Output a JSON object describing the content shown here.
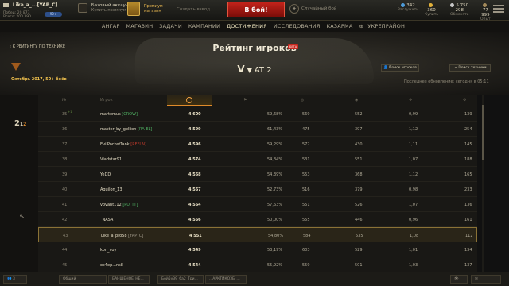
{
  "topbar": {
    "nickname": "Like_a_...[YAP_C]",
    "wins_line1": "Побед: 20 873",
    "wins_line2": "Всего: 200 390",
    "clan_badge": "90+",
    "account_line1": "Базовый аккаунт",
    "account_line2": "Купить премиум",
    "premium_line1": "Премиум",
    "premium_line2": "магазин",
    "platoon": "Создать взвод",
    "battle_button": "В бой!",
    "mode": "Случайный бой",
    "currencies": [
      {
        "value": "342",
        "label": "Заслужить",
        "color": "#4e9bd8"
      },
      {
        "value": "360",
        "label": "Купить",
        "color": "#e2b13a"
      },
      {
        "value": "5 750 298",
        "label": "Обменять",
        "color": "#c7c7c7"
      },
      {
        "value": "77 999",
        "label": "Опыт",
        "color": "#a48a5a"
      }
    ]
  },
  "nav": {
    "items": [
      {
        "label": "АНГАР",
        "active": false
      },
      {
        "label": "МАГАЗИН",
        "active": false
      },
      {
        "label": "ЗАДАЧИ",
        "active": false
      },
      {
        "label": "КАМПАНИИ",
        "active": false
      },
      {
        "label": "ДОСТИЖЕНИЯ",
        "active": true
      },
      {
        "label": "ИССЛЕДОВАНИЯ",
        "active": false
      },
      {
        "label": "КАЗАРМА",
        "active": false
      },
      {
        "label": "УКРЕПРАЙОН",
        "active": false
      }
    ]
  },
  "page": {
    "back_link": "К РЕЙТИНГУ ПО ТЕХНИКЕ",
    "title": "Рейтинг игроков",
    "beta": "БЕТА",
    "tier": "V",
    "vehicle_class": "AT 2",
    "season": "Октябрь 2017, 50+ боёв",
    "search_players": "Поиск игроков",
    "search_vehicles": "Поиск техники",
    "last_update": "Последнее обновление: сегодня в 05:11"
  },
  "table": {
    "headers": {
      "rank": "№",
      "player": "Игрок"
    },
    "rows": [
      {
        "rank": "35",
        "delta": "+1",
        "name": "martemus",
        "clan": "[CROW]",
        "clan_color": "#4fb062",
        "score": "4 600",
        "c1": "59,68%",
        "c2": "569",
        "c3": "552",
        "c4": "0,99",
        "c5": "139",
        "highlight": false
      },
      {
        "rank": "36",
        "delta": "",
        "name": "master_by_gellion",
        "clan": "[RA-EL]",
        "clan_color": "#4fb062",
        "score": "4 599",
        "c1": "61,43%",
        "c2": "475",
        "c3": "397",
        "c4": "1,12",
        "c5": "254",
        "highlight": false
      },
      {
        "rank": "37",
        "delta": "",
        "name": "EvilPocketTank",
        "clan": "[RFFLN]",
        "clan_color": "#c0392b",
        "score": "4 596",
        "c1": "59,29%",
        "c2": "572",
        "c3": "430",
        "c4": "1,11",
        "c5": "145",
        "highlight": false
      },
      {
        "rank": "38",
        "delta": "",
        "name": "Vladstar91",
        "clan": "",
        "clan_color": "#4fb062",
        "score": "4 574",
        "c1": "54,34%",
        "c2": "531",
        "c3": "551",
        "c4": "1,07",
        "c5": "188",
        "highlight": false
      },
      {
        "rank": "39",
        "delta": "",
        "name": "YeDD",
        "clan": "",
        "clan_color": "#4fb062",
        "score": "4 568",
        "c1": "54,39%",
        "c2": "553",
        "c3": "368",
        "c4": "1,12",
        "c5": "165",
        "highlight": false
      },
      {
        "rank": "40",
        "delta": "",
        "name": "Aquilon_13",
        "clan": "",
        "clan_color": "#4fb062",
        "score": "4 567",
        "c1": "52,73%",
        "c2": "516",
        "c3": "379",
        "c4": "0,98",
        "c5": "233",
        "highlight": false
      },
      {
        "rank": "41",
        "delta": "",
        "name": "vovant112",
        "clan": "[PU_TT]",
        "clan_color": "#4fb062",
        "score": "4 564",
        "c1": "57,63%",
        "c2": "551",
        "c3": "526",
        "c4": "1,07",
        "c5": "136",
        "highlight": false
      },
      {
        "rank": "42",
        "delta": "",
        "name": "_NASA",
        "clan": "",
        "clan_color": "#4fb062",
        "score": "4 556",
        "c1": "50,00%",
        "c2": "555",
        "c3": "446",
        "c4": "0,96",
        "c5": "161",
        "highlight": false
      },
      {
        "rank": "43",
        "delta": "",
        "name": "Like_a_pro58",
        "clan": "[YAP_C]",
        "clan_color": "#9c9585",
        "score": "4 551",
        "c1": "54,80%",
        "c2": "584",
        "c3": "535",
        "c4": "1,08",
        "c5": "112",
        "highlight": true
      },
      {
        "rank": "44",
        "delta": "",
        "name": "kon_voy",
        "clan": "",
        "clan_color": "#4fb062",
        "score": "4 549",
        "c1": "53,19%",
        "c2": "603",
        "c3": "529",
        "c4": "1,01",
        "c5": "134",
        "highlight": false
      },
      {
        "rank": "45",
        "delta": "",
        "name": "oc4ep...ns8",
        "clan": "",
        "clan_color": "#4fb062",
        "score": "4 544",
        "c1": "55,92%",
        "c2": "559",
        "c3": "501",
        "c4": "1,03",
        "c5": "137",
        "highlight": false
      }
    ]
  },
  "bottombar": {
    "squad_count": "3",
    "chat": "Общий",
    "tabs": [
      "БАНШЕНОЕ_НЕ...",
      "Бой5у39_6a2_Три...",
      "...АРКТИКОЗБ_..."
    ]
  }
}
